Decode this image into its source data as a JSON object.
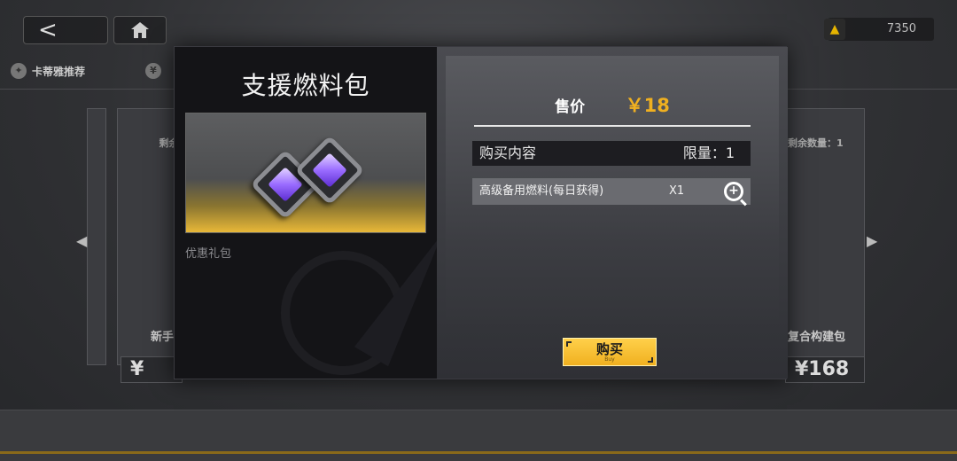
{
  "header": {
    "back_glyph": "<",
    "currency_value": "7350",
    "currency_icon": "triangle-coin-icon"
  },
  "nav": {
    "tab1": "卡蒂雅推荐",
    "tab2_icon": "¥"
  },
  "background_cards": [
    {
      "remain": "剩余数",
      "name": "新手构建",
      "price": "¥"
    },
    {
      "remain": "剩余数量：1",
      "name": "复合构建包",
      "price": "¥168"
    }
  ],
  "modal": {
    "title": "支援燃料包",
    "category": "优惠礼包",
    "price_label": "售价",
    "price_value": "￥18",
    "content_label": "购买内容",
    "limit_label": "限量：1",
    "items": [
      {
        "name": "高级备用燃料(每日获得)",
        "qty": "X1"
      }
    ],
    "buy_label": "购买",
    "buy_sub": "Buy"
  }
}
